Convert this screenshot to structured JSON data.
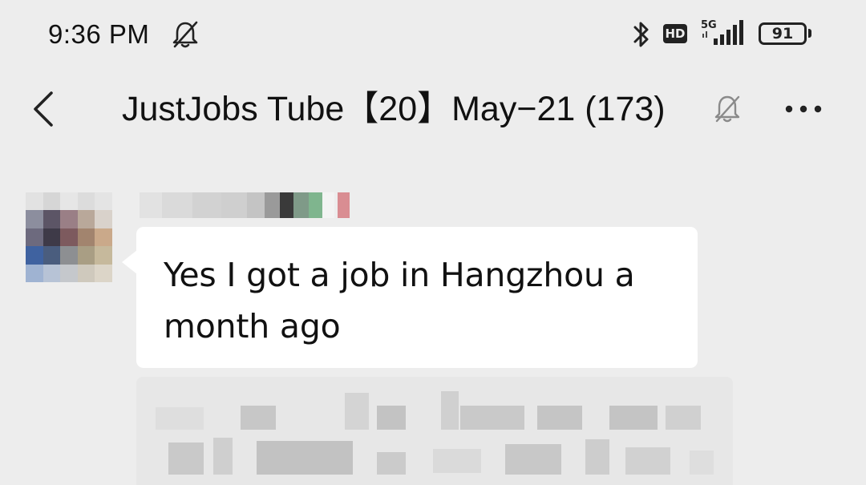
{
  "status_bar": {
    "time": "9:36 PM",
    "network": "5G",
    "hd_label": "HD",
    "battery_level": "91"
  },
  "header": {
    "title": "JustJobs Tube【20】May−21 (173)"
  },
  "messages": [
    {
      "text": "Yes I got a job in Hangzhou a month ago"
    }
  ],
  "colors": {
    "background": "#ededed",
    "bubble": "#ffffff",
    "text": "#111111"
  },
  "icons": {
    "status_mute": "bell-slash-icon",
    "bluetooth": "bluetooth-icon",
    "signal": "signal-icon",
    "back": "chevron-left-icon",
    "chat_muted": "bell-slash-icon",
    "more": "more-icon"
  }
}
